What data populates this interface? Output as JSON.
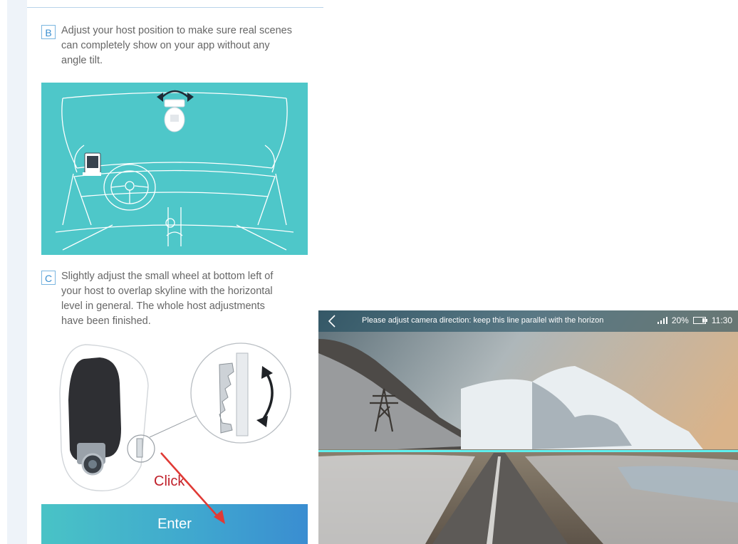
{
  "steps": {
    "b": {
      "badge": "B",
      "lines": [
        "Adjust your host position to make sure real scenes",
        "can completely show on your app without any",
        "angle tilt."
      ]
    },
    "c": {
      "badge": "C",
      "lines": [
        "Slightly adjust the small wheel at bottom left of",
        "your host to overlap skyline with the horizontal",
        "level in general. The whole host adjustments",
        "have been finished."
      ]
    }
  },
  "annotation": {
    "click_label": "Click"
  },
  "enter_button": {
    "label": "Enter"
  },
  "camera_view": {
    "title": "Please adjust camera direction: keep this line parallel with the horizon",
    "battery": "20%",
    "time": "11:30",
    "signal_icon": "signal-bars-icon",
    "battery_icon": "battery-icon",
    "back_icon": "chevron-left-icon"
  },
  "colors": {
    "teal": "#4ec7c9",
    "accent_blue": "#3a8fd0",
    "horizon_line": "#5ff0ee",
    "click_red": "#c0202a"
  }
}
